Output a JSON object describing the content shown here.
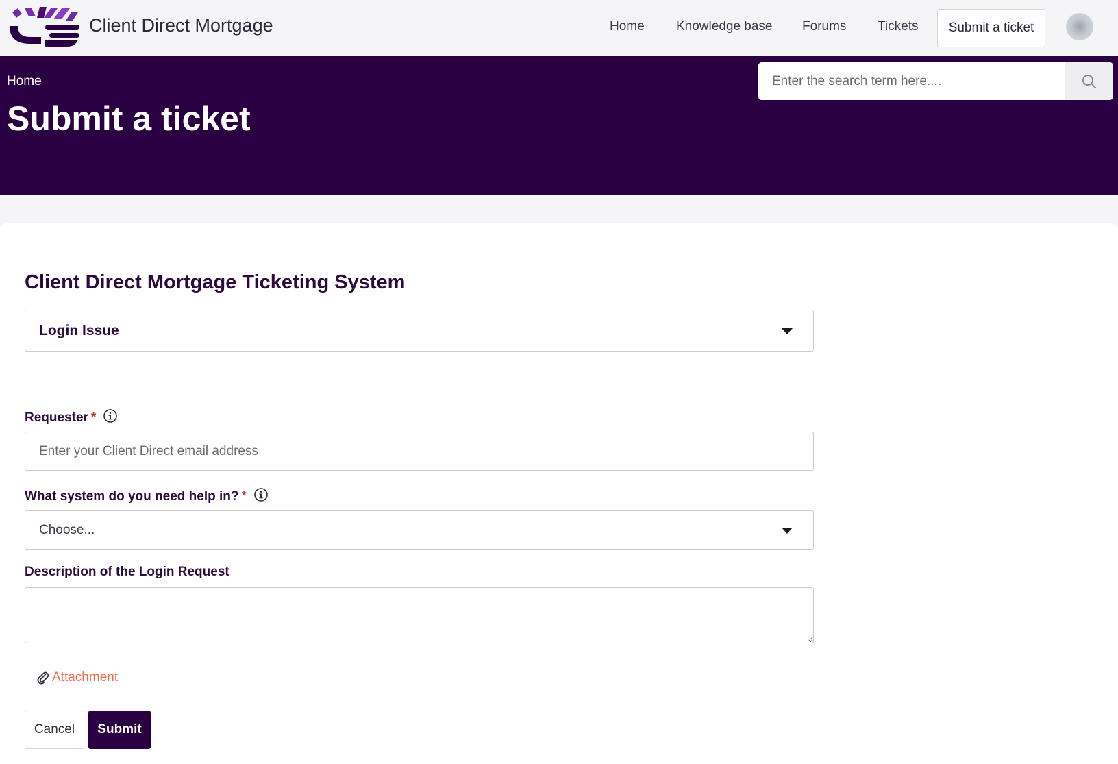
{
  "header": {
    "brand_name": "Client Direct Mortgage",
    "nav": [
      "Home",
      "Knowledge base",
      "Forums",
      "Tickets"
    ],
    "submit_ticket": "Submit a ticket"
  },
  "hero": {
    "breadcrumb": "Home",
    "title": "Submit a ticket",
    "search_placeholder": "Enter the search term here...."
  },
  "form": {
    "section_title": "Client Direct Mortgage Ticketing System",
    "ticket_type": "Login Issue",
    "requester_label": "Requester",
    "requester_placeholder": "Enter your Client Direct email address",
    "system_label": "What system do you need help in?",
    "system_value": "Choose...",
    "description_label": "Description of the Login Request",
    "required_mark": "*",
    "attachment": "Attachment",
    "cancel": "Cancel",
    "submit": "Submit"
  },
  "colors": {
    "brand_purple": "#2b0042",
    "accent_orange": "#ef6c4a",
    "required_red": "#c0392b"
  }
}
